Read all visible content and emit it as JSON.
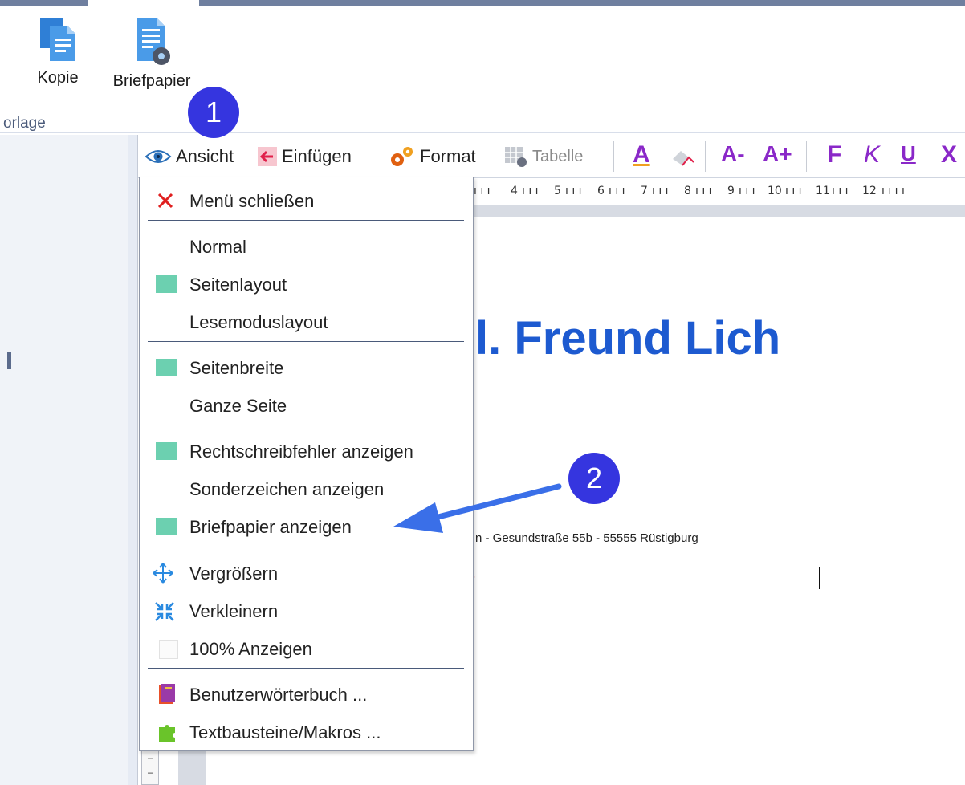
{
  "ribbon": {
    "buttons": [
      {
        "label": "Kopie",
        "icon": "copy-document-icon"
      },
      {
        "label": "Briefpapier",
        "icon": "letter-paper-settings-icon"
      }
    ],
    "group_label": "orlage"
  },
  "toolbar": {
    "ansicht": {
      "label": "Ansicht",
      "icon": "eye-icon"
    },
    "einfuegen": {
      "label": "Einfügen",
      "icon": "insert-arrow-icon"
    },
    "format": {
      "label": "Format",
      "icon": "gears-icon"
    },
    "tabelle": {
      "label": "Tabelle",
      "icon": "table-settings-icon"
    },
    "format_buttons": [
      "A",
      "A-",
      "A+",
      "F",
      "K",
      "U",
      "X"
    ]
  },
  "ruler": {
    "numbers": [
      "4",
      "5",
      "6",
      "7",
      "8",
      "9",
      "10",
      "11",
      "12"
    ]
  },
  "document": {
    "heading": "l. Freund Lich",
    "address": "n - Gesundstraße 55b - 55555 Rüstigburg",
    "red_mark": "›"
  },
  "menu": {
    "close": "Menü schließen",
    "normal": "Normal",
    "seitenlayout": "Seitenlayout",
    "lesemodus": "Lesemoduslayout",
    "seitenbreite": "Seitenbreite",
    "ganze_seite": "Ganze Seite",
    "rechtschreib": "Rechtschreibfehler anzeigen",
    "sonderzeichen": "Sonderzeichen anzeigen",
    "briefpapier": "Briefpapier anzeigen",
    "vergroessern": "Vergrößern",
    "verkleinern": "Verkleinern",
    "hundert": "100% Anzeigen",
    "benutzer": "Benutzerwörterbuch ...",
    "textbausteine": "Textbausteine/Makros ...",
    "checked_color": "#6cd0b0"
  },
  "callouts": {
    "one": "1",
    "two": "2",
    "color": "#3535df"
  }
}
